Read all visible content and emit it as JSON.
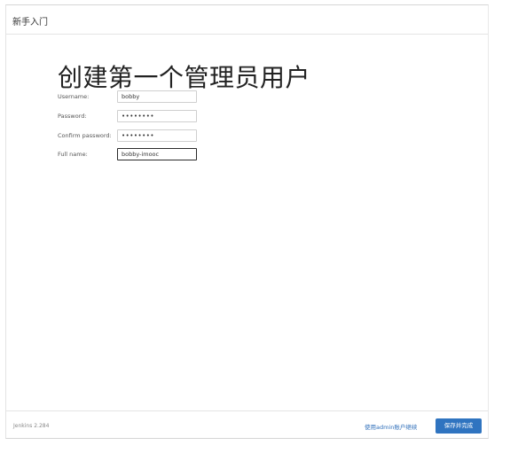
{
  "dialog": {
    "title": "新手入门",
    "heading": "创建第一个管理员用户"
  },
  "form": {
    "fields": [
      {
        "label": "Username:",
        "value": "bobby"
      },
      {
        "label": "Password:",
        "value": "••••••••"
      },
      {
        "label": "Confirm password:",
        "value": "••••••••"
      },
      {
        "label": "Full name:",
        "value": "bobby-imooc"
      }
    ]
  },
  "footer": {
    "version": "Jenkins 2.284",
    "continue_as_admin_label": "使用admin账户继续",
    "save_finish_label": "保存并完成"
  },
  "colors": {
    "primary_button": "#2f74c0",
    "link": "#2f6fba"
  }
}
